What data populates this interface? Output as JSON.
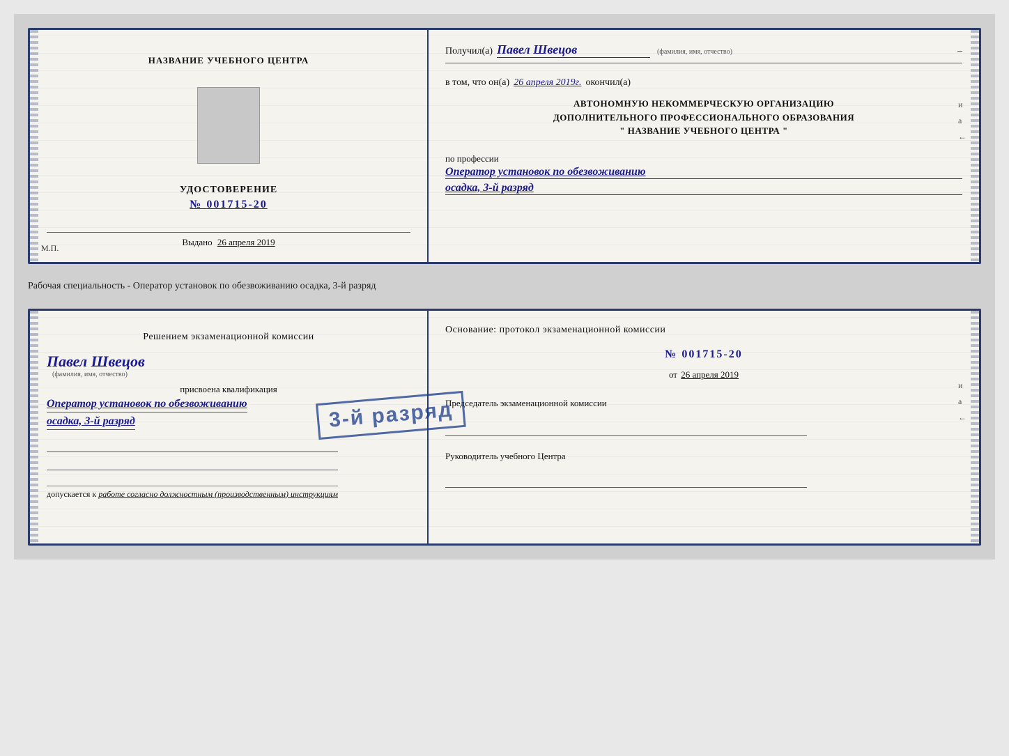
{
  "background_color": "#d4d4d4",
  "doc1": {
    "left": {
      "title": "НАЗВАНИЕ УЧЕБНОГО ЦЕНТРА",
      "cert_label": "УДОСТОВЕРЕНИЕ",
      "cert_number_prefix": "№",
      "cert_number": "001715-20",
      "issued_label": "Выдано",
      "issued_date": "26 апреля 2019",
      "mp_label": "М.П."
    },
    "right": {
      "received_prefix": "Получил(а)",
      "received_name": "Павел Швецов",
      "fio_label": "(фамилия, имя, отчество)",
      "dash": "–",
      "in_that_prefix": "в том, что он(а)",
      "in_that_date": "26 апреля 2019г.",
      "finished_label": "окончил(а)",
      "org_line1": "АВТОНОМНУЮ НЕКОММЕРЧЕСКУЮ ОРГАНИЗАЦИЮ",
      "org_line2": "ДОПОЛНИТЕЛЬНОГО ПРОФЕССИОНАЛЬНОГО ОБРАЗОВАНИЯ",
      "org_line3": "\" НАЗВАНИЕ УЧЕБНОГО ЦЕНТРА \"",
      "side_char1": "и",
      "side_char2": "а",
      "side_char3": "←",
      "profession_label": "по профессии",
      "profession_value": "Оператор установок по обезвоживанию",
      "profession_sub": "осадка, 3-й разряд"
    }
  },
  "separator": {
    "text": "Рабочая специальность - Оператор установок по обезвоживанию осадка, 3-й разряд"
  },
  "doc2": {
    "left": {
      "title": "Решением экзаменационной комиссии",
      "person_name": "Павел Швецов",
      "fio_label": "(фамилия, имя, отчество)",
      "assigned_label": "присвоена квалификация",
      "qualification_value": "Оператор установок по обезвоживанию",
      "qualification_sub": "осадка, 3-й разряд",
      "admitted_prefix": "допускается к",
      "admitted_italic": "работе согласно должностным (производственным) инструкциям"
    },
    "right": {
      "basis_label": "Основание: протокол экзаменационной комиссии",
      "protocol_number": "№ 001715-20",
      "protocol_date_prefix": "от",
      "protocol_date": "26 апреля 2019",
      "stamp_text": "3-й разряд",
      "chairman_label": "Председатель экзаменационной комиссии",
      "head_label": "Руководитель учебного Центра",
      "side_char1": "и",
      "side_char2": "а",
      "side_char3": "←"
    }
  }
}
